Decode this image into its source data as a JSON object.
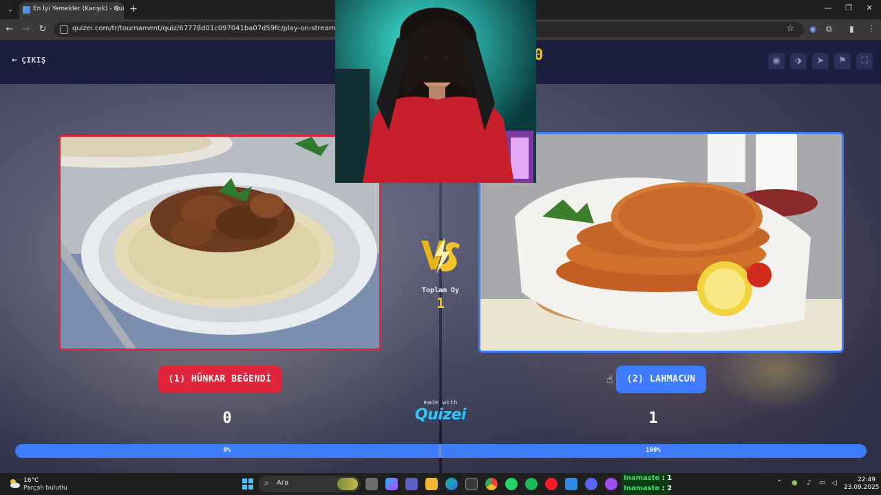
{
  "browser": {
    "tab_title": "En İyi Yemekler (Karışık) - Quize",
    "tab_close": "×",
    "new_tab": "+",
    "url": "quizei.com/tr/tournament/quiz/67778d01c097041ba07d59fc/play-on-stream",
    "win_min": "—",
    "win_restore": "❐",
    "win_close": "✕"
  },
  "app": {
    "exit_arrow": "←",
    "exit_label": "ÇIKIŞ",
    "title_fragment": "0",
    "toolbar_icons": [
      "eye-icon",
      "tag-icon",
      "send-icon",
      "flag-icon",
      "fullscreen-icon"
    ],
    "total_votes_label": "Toplam Oy",
    "total_votes_value": "1",
    "left": {
      "label": "(1) HÜNKAR BEĞENDİ",
      "count": "0",
      "percent": "0%",
      "color": "#e0243c"
    },
    "right": {
      "label": "(2) LAHMACUN",
      "count": "1",
      "percent": "100%",
      "color": "#3d7bff"
    },
    "left_share": 0,
    "made_with": "made with",
    "logo_text": "Quizei"
  },
  "taskbar": {
    "temperature": "16°C",
    "condition": "Parçalı bulutlu",
    "search_placeholder": "Ara",
    "chat": [
      {
        "name": "Inamaste",
        "text": " : 1"
      },
      {
        "name": "Inamaste",
        "text": " : 2"
      }
    ],
    "time": "22:49",
    "date": "23.09.2025"
  }
}
